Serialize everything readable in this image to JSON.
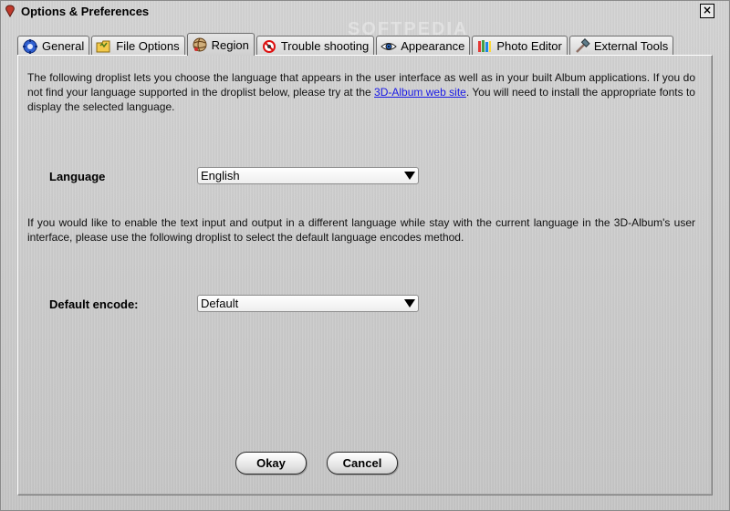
{
  "window": {
    "title": "Options & Preferences",
    "close_label": "×",
    "watermark": "SOFTPEDIA"
  },
  "tabs": [
    {
      "label": "General",
      "icon": "gear-icon"
    },
    {
      "label": "File Options",
      "icon": "folder-icon"
    },
    {
      "label": "Region",
      "icon": "globe-icon",
      "active": true
    },
    {
      "label": "Trouble shooting",
      "icon": "no-entry-icon"
    },
    {
      "label": "Appearance",
      "icon": "eye-icon"
    },
    {
      "label": "Photo Editor",
      "icon": "paint-brushes-icon"
    },
    {
      "label": "External Tools",
      "icon": "hammer-icon"
    }
  ],
  "region": {
    "intro_before_link": "The following droplist lets you choose the language that appears in the user interface as well as in your built Album applications. If you do not find your language supported in the droplist below, please try at the ",
    "intro_link": "3D-Album web site",
    "intro_after_link": ". You will need to install the appropriate fonts to display the selected language.",
    "language_label": "Language",
    "language_value": "English",
    "encode_paragraph": "If you would like to enable the text input and output in a different language while stay with the current language in the 3D-Album's user interface, please use the following droplist to select the default language encodes method.",
    "encode_label": "Default encode:",
    "encode_value": "Default"
  },
  "buttons": {
    "ok_label": "Okay",
    "cancel_label": "Cancel"
  },
  "colors": {
    "link": "#1a1ae6",
    "panel_bg": "#c9c9c9"
  }
}
